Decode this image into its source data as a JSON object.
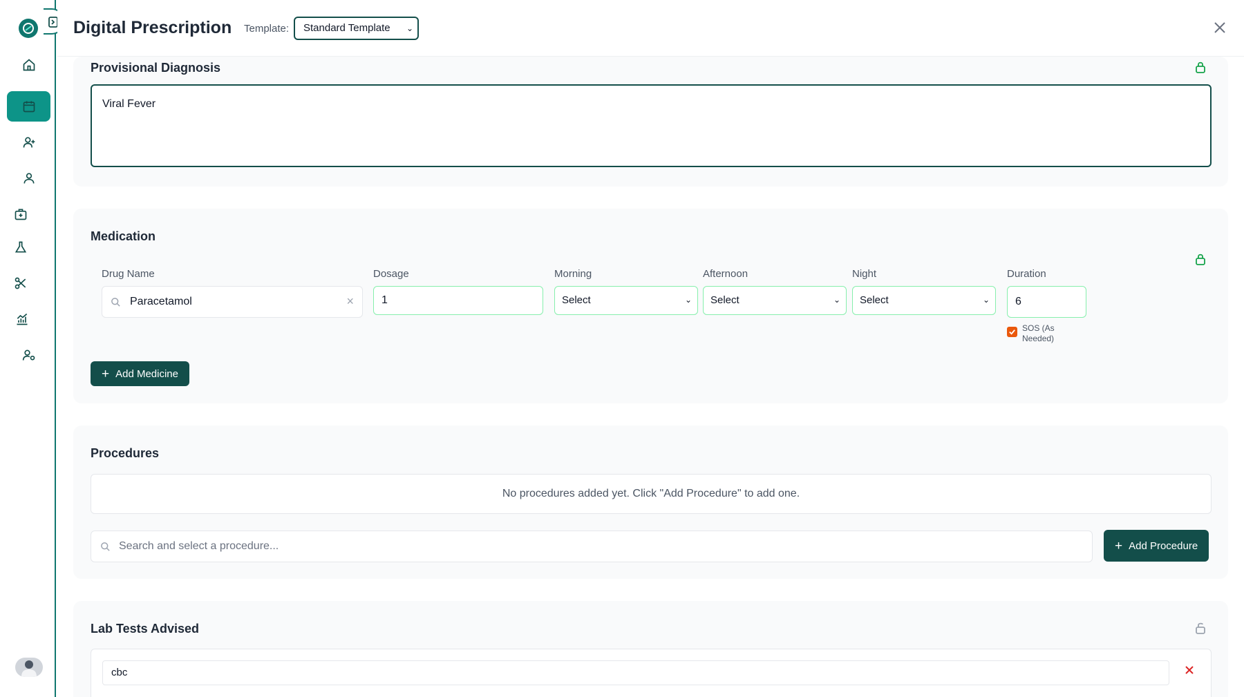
{
  "header": {
    "title": "Digital Prescription",
    "template_label": "Template:",
    "template_value": "Standard Template"
  },
  "sidebar": {
    "items": [
      {
        "icon": "home-icon",
        "active": false
      },
      {
        "icon": "calendar-icon",
        "active": true
      },
      {
        "icon": "user-plus-icon",
        "active": false
      },
      {
        "icon": "user-icon",
        "active": false
      },
      {
        "icon": "medical-kit-icon",
        "active": false
      },
      {
        "icon": "flask-icon",
        "active": false
      },
      {
        "icon": "scissors-icon",
        "active": false
      },
      {
        "icon": "analytics-icon",
        "active": false
      },
      {
        "icon": "user-settings-icon",
        "active": false
      }
    ]
  },
  "diagnosis": {
    "title": "Provisional Diagnosis",
    "value": "Viral Fever"
  },
  "medication": {
    "title": "Medication",
    "labels": {
      "drug": "Drug Name",
      "dosage": "Dosage",
      "morning": "Morning",
      "afternoon": "Afternoon",
      "night": "Night",
      "duration": "Duration"
    },
    "row": {
      "drug": "Paracetamol",
      "dosage": "1",
      "morning": "Select",
      "afternoon": "Select",
      "night": "Select",
      "duration": "6",
      "sos_line1": "SOS (As",
      "sos_line2": "Needed)",
      "sos_checked": true
    },
    "add_label": "Add Medicine"
  },
  "procedures": {
    "title": "Procedures",
    "empty_text": "No procedures added yet. Click \"Add Procedure\" to add one.",
    "search_placeholder": "Search and select a procedure...",
    "add_label": "Add Procedure"
  },
  "lab_tests": {
    "title": "Lab Tests Advised",
    "items": [
      "cbc"
    ]
  },
  "colors": {
    "primary": "#134e4a",
    "accent": "#0d9488",
    "lock": "#16a34a",
    "checkbox": "#ea580c"
  }
}
